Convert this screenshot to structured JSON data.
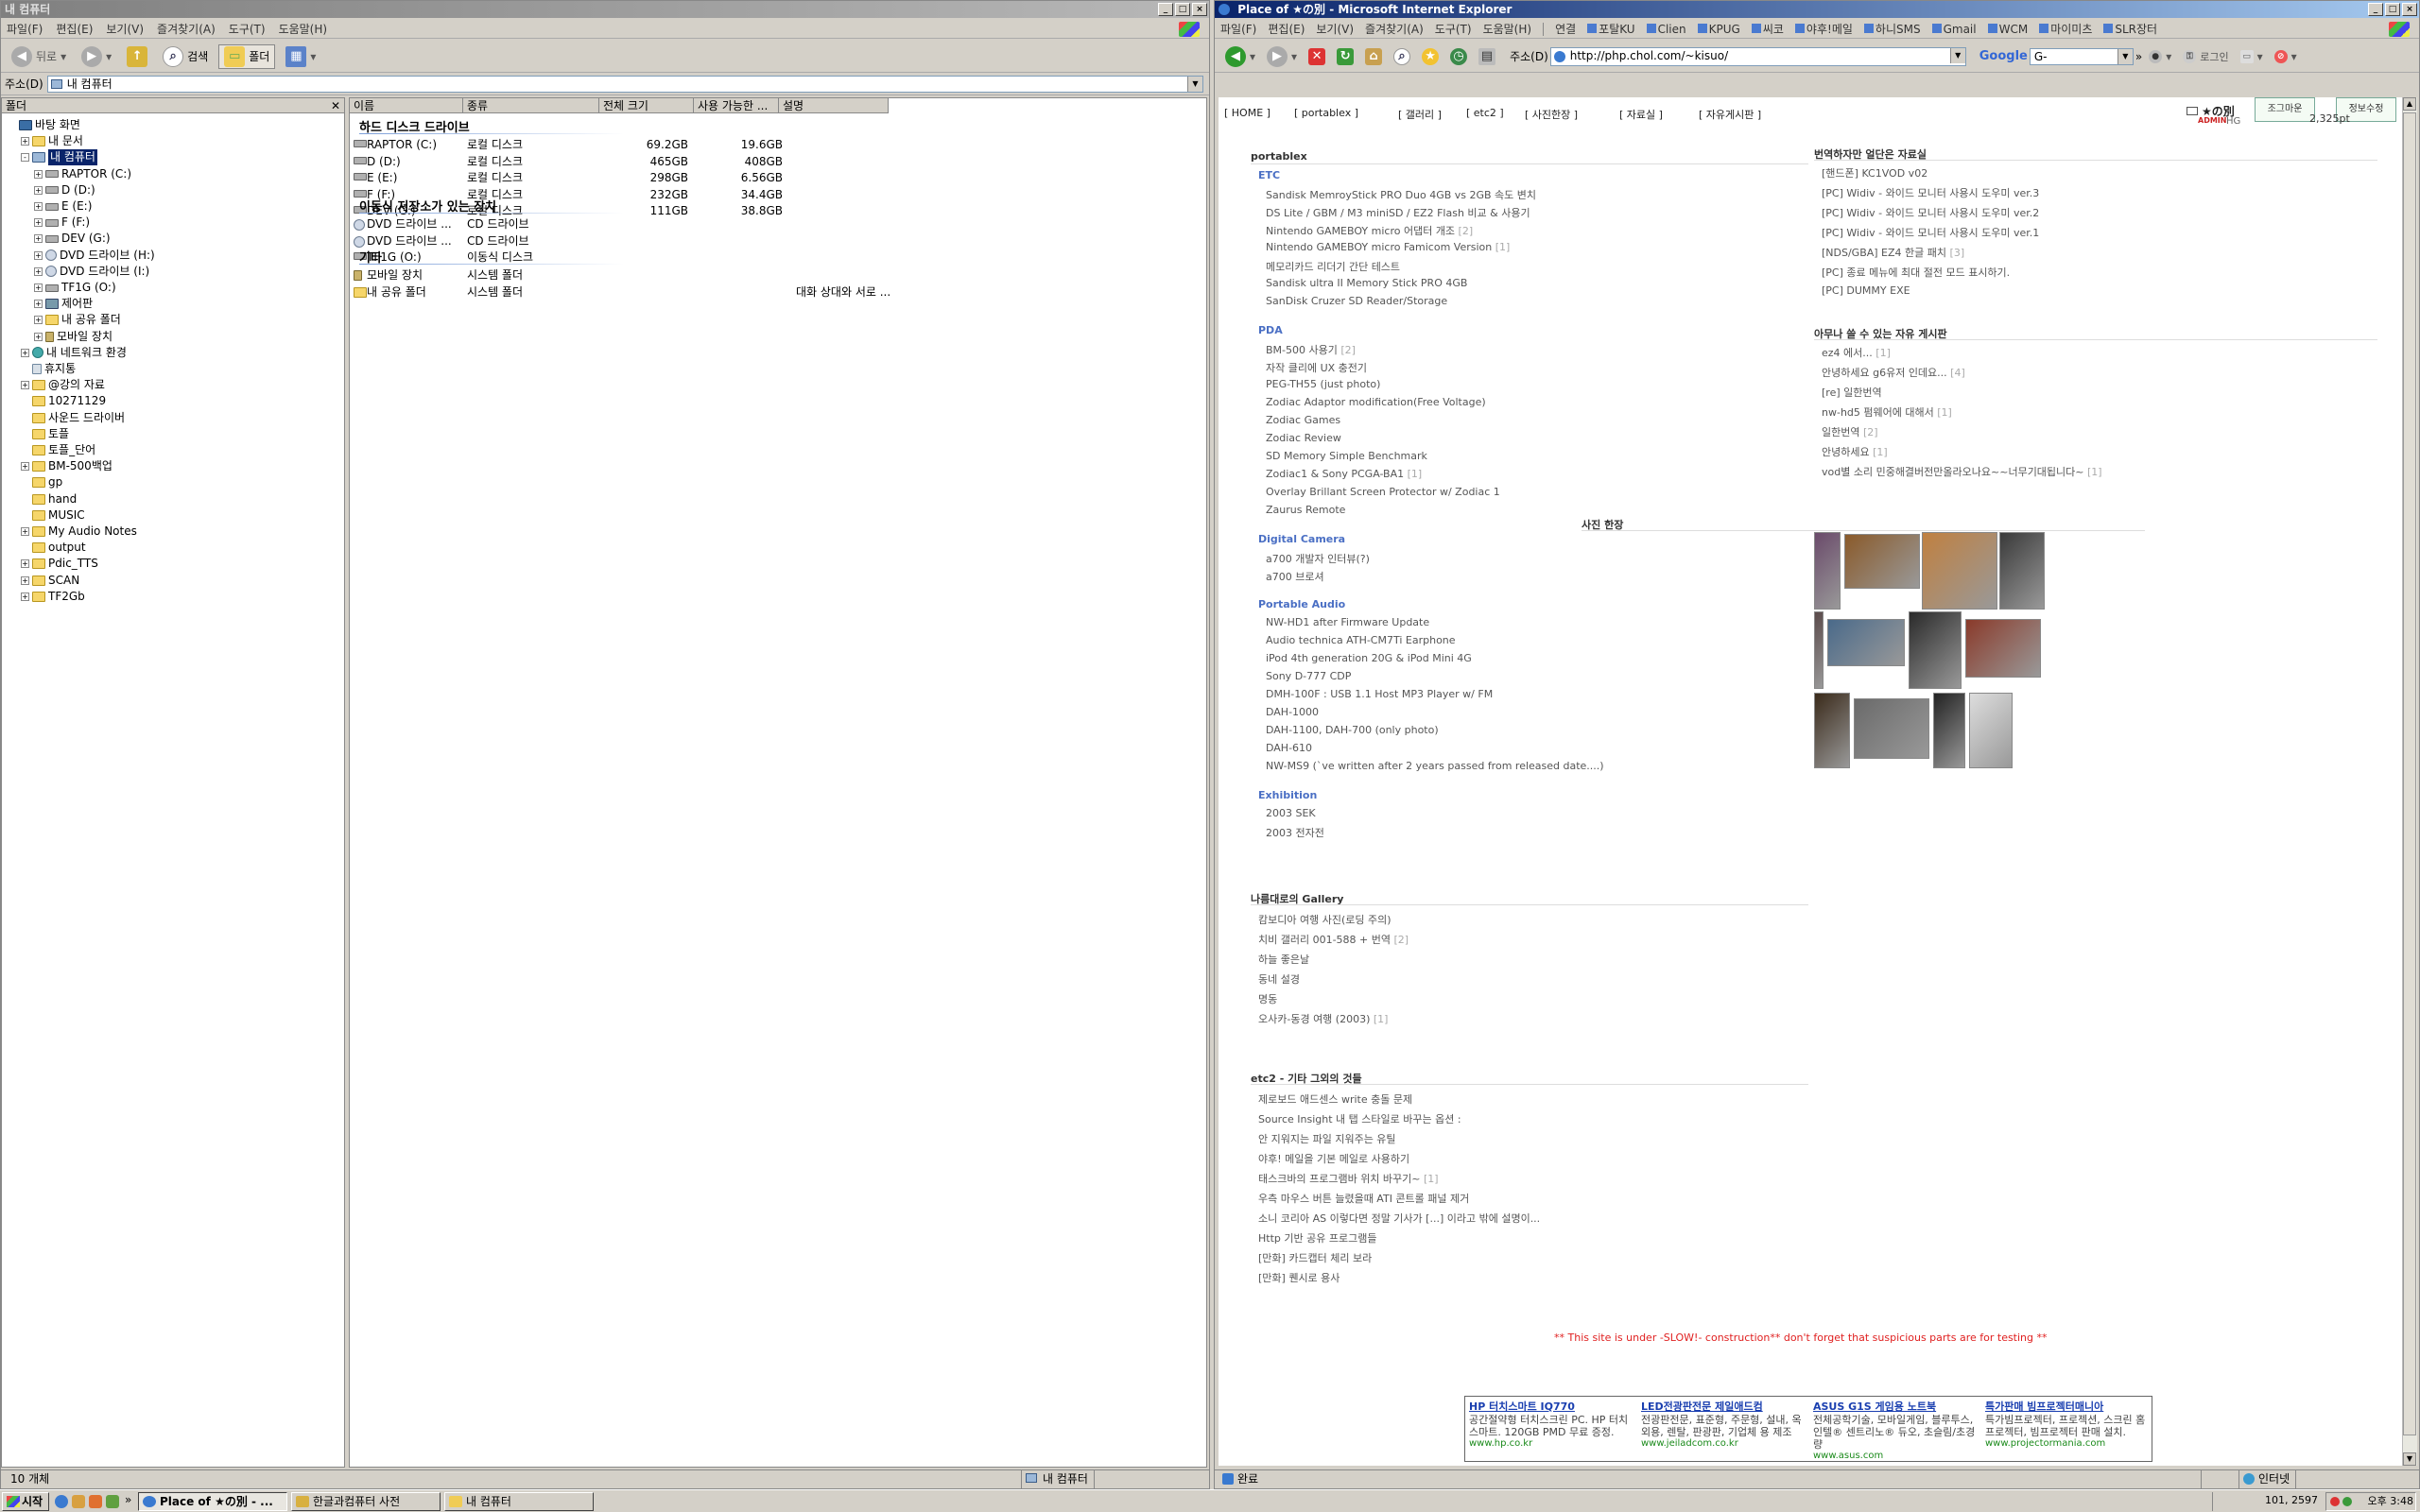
{
  "explorer": {
    "title": "내 컴퓨터",
    "menu": [
      "파일(F)",
      "편집(E)",
      "보기(V)",
      "즐겨찾기(A)",
      "도구(T)",
      "도움말(H)"
    ],
    "toolbar": {
      "back": "뒤로",
      "search": "검색",
      "folders": "폴더"
    },
    "address_label": "주소(D)",
    "address_value": "내 컴퓨터",
    "tree_header": "폴더",
    "tree": [
      {
        "label": "바탕 화면",
        "icon": "desk",
        "level": 0,
        "exp": ""
      },
      {
        "label": "내 문서",
        "icon": "folder",
        "level": 1,
        "exp": "+"
      },
      {
        "label": "내 컴퓨터",
        "icon": "pc",
        "level": 1,
        "exp": "-",
        "selected": true
      },
      {
        "label": "RAPTOR (C:)",
        "icon": "drive",
        "level": 2,
        "exp": "+"
      },
      {
        "label": "D (D:)",
        "icon": "drive",
        "level": 2,
        "exp": "+"
      },
      {
        "label": "E (E:)",
        "icon": "drive",
        "level": 2,
        "exp": "+"
      },
      {
        "label": "F (F:)",
        "icon": "drive",
        "level": 2,
        "exp": "+"
      },
      {
        "label": "DEV (G:)",
        "icon": "drive",
        "level": 2,
        "exp": "+"
      },
      {
        "label": "DVD 드라이브 (H:)",
        "icon": "cd",
        "level": 2,
        "exp": "+"
      },
      {
        "label": "DVD 드라이브 (I:)",
        "icon": "cd",
        "level": 2,
        "exp": "+"
      },
      {
        "label": "TF1G (O:)",
        "icon": "drive",
        "level": 2,
        "exp": "+"
      },
      {
        "label": "제어판",
        "icon": "ctrl",
        "level": 2,
        "exp": "+"
      },
      {
        "label": "내 공유 폴더",
        "icon": "folder",
        "level": 2,
        "exp": "+"
      },
      {
        "label": "모바일 장치",
        "icon": "mobile",
        "level": 2,
        "exp": "+"
      },
      {
        "label": "내 네트워크 환경",
        "icon": "net",
        "level": 1,
        "exp": "+"
      },
      {
        "label": "휴지통",
        "icon": "trash",
        "level": 1,
        "exp": ""
      },
      {
        "label": "@강의 자료",
        "icon": "folder",
        "level": 1,
        "exp": "+"
      },
      {
        "label": "10271129",
        "icon": "folder",
        "level": 1,
        "exp": ""
      },
      {
        "label": "사운드 드라이버",
        "icon": "folder",
        "level": 1,
        "exp": ""
      },
      {
        "label": "토플",
        "icon": "folder",
        "level": 1,
        "exp": ""
      },
      {
        "label": "토플_단어",
        "icon": "folder",
        "level": 1,
        "exp": ""
      },
      {
        "label": "BM-500백업",
        "icon": "folder",
        "level": 1,
        "exp": "+"
      },
      {
        "label": "gp",
        "icon": "folder",
        "level": 1,
        "exp": ""
      },
      {
        "label": "hand",
        "icon": "folder",
        "level": 1,
        "exp": ""
      },
      {
        "label": "MUSIC",
        "icon": "folder",
        "level": 1,
        "exp": ""
      },
      {
        "label": "My Audio Notes",
        "icon": "folder",
        "level": 1,
        "exp": "+"
      },
      {
        "label": "output",
        "icon": "folder",
        "level": 1,
        "exp": ""
      },
      {
        "label": "Pdic_TTS",
        "icon": "folder",
        "level": 1,
        "exp": "+"
      },
      {
        "label": "SCAN",
        "icon": "folder",
        "level": 1,
        "exp": "+"
      },
      {
        "label": "TF2Gb",
        "icon": "folder",
        "level": 1,
        "exp": "+"
      }
    ],
    "columns": [
      "이름",
      "종류",
      "전체 크기",
      "사용 가능한 ...",
      "설명"
    ],
    "groups": [
      {
        "title": "하드 디스크 드라이브",
        "rows": [
          {
            "name": "RAPTOR (C:)",
            "type": "로컬 디스크",
            "total": "69.2GB",
            "free": "19.6GB",
            "desc": "",
            "icon": "drive"
          },
          {
            "name": "D (D:)",
            "type": "로컬 디스크",
            "total": "465GB",
            "free": "408GB",
            "desc": "",
            "icon": "drive"
          },
          {
            "name": "E (E:)",
            "type": "로컬 디스크",
            "total": "298GB",
            "free": "6.56GB",
            "desc": "",
            "icon": "drive"
          },
          {
            "name": "F (F:)",
            "type": "로컬 디스크",
            "total": "232GB",
            "free": "34.4GB",
            "desc": "",
            "icon": "drive"
          },
          {
            "name": "DEV (G:)",
            "type": "로컬 디스크",
            "total": "111GB",
            "free": "38.8GB",
            "desc": "",
            "icon": "drive"
          }
        ]
      },
      {
        "title": "이동식 저장소가 있는 장치",
        "rows": [
          {
            "name": "DVD 드라이브 ...",
            "type": "CD 드라이브",
            "total": "",
            "free": "",
            "desc": "",
            "icon": "cd"
          },
          {
            "name": "DVD 드라이브 ...",
            "type": "CD 드라이브",
            "total": "",
            "free": "",
            "desc": "",
            "icon": "cd"
          },
          {
            "name": "TF1G (O:)",
            "type": "이동식 디스크",
            "total": "",
            "free": "",
            "desc": "",
            "icon": "drive"
          }
        ]
      },
      {
        "title": "기타",
        "rows": [
          {
            "name": "모바일 장치",
            "type": "시스템 폴더",
            "total": "",
            "free": "",
            "desc": "",
            "icon": "mobile"
          },
          {
            "name": "내 공유 폴더",
            "type": "시스템 폴더",
            "total": "",
            "free": "",
            "desc": "대화 상대와 서로 ...",
            "icon": "folder"
          }
        ]
      }
    ],
    "status_left": "10 개체",
    "status_right": "내 컴퓨터"
  },
  "ie": {
    "title": "Place of ★の別 - Microsoft Internet Explorer",
    "menu": [
      "파일(F)",
      "편집(E)",
      "보기(V)",
      "즐겨찾기(A)",
      "도구(T)",
      "도움말(H)"
    ],
    "links": [
      "연결",
      "포탈KU",
      "Clien",
      "KPUG",
      "씨코",
      "야후!메일",
      "하니SMS",
      "Gmail",
      "WCM",
      "마이미츠",
      "SLR장터"
    ],
    "address_label": "주소(D)",
    "address_value": "http://php.chol.com/~kisuo/",
    "google_label": "Google",
    "google_input": "G-",
    "login_label": "로그인",
    "nav": [
      "[ HOME ]",
      "[ portablex ]",
      "[ 갤러리 ]",
      "[ etc2 ]",
      "[ 사진한장 ]",
      "[ 자료실 ]",
      "[ 자유게시판 ]"
    ],
    "site_logo": "★の別",
    "admin_label": "ADMIN",
    "admin_user": "HG",
    "visit_btn": "조그마운",
    "info_btn": "정보수정",
    "points": "2,325pt",
    "portablex": {
      "title": "portablex",
      "sections": [
        {
          "title": "ETC",
          "items": [
            "Sandisk MemroyStick PRO Duo 4GB vs 2GB 속도 변치",
            "DS Lite / GBM / M3 miniSD / EZ2 Flash 비교 & 사용기",
            "Nintendo GAMEBOY micro 어댑터 개조 [2]",
            "Nintendo GAMEBOY micro Famicom Version [1]",
            "메모리카드 리더기 간단 테스트",
            "Sandisk ultra II Memory Stick PRO 4GB",
            "SanDisk Cruzer SD Reader/Storage"
          ]
        },
        {
          "title": "PDA",
          "items": [
            "BM-500 사용기 [2]",
            "자작 클리에 UX 충전기",
            "PEG-TH55 (just photo)",
            "Zodiac Adaptor modification(Free Voltage)",
            "Zodiac Games",
            "Zodiac Review",
            "SD Memory Simple Benchmark",
            "Zodiac1 & Sony PCGA-BA1 [1]",
            "Overlay Brillant Screen Protector w/ Zodiac 1",
            "Zaurus Remote"
          ]
        },
        {
          "title": "Digital Camera",
          "items": [
            "a700 개발자 인터뷰(?)",
            "a700 브로셔"
          ]
        },
        {
          "title": "Portable Audio",
          "items": [
            "NW-HD1 after Firmware Update",
            "Audio technica ATH-CM7Ti Earphone",
            "iPod 4th generation 20G & iPod Mini 4G",
            "Sony D-777 CDP",
            "DMH-100F : USB 1.1 Host MP3 Player w/ FM",
            "DAH-1000",
            "DAH-1100, DAH-700 (only photo)",
            "DAH-610",
            "NW-MS9 (`ve written after 2 years passed from released date....)"
          ]
        },
        {
          "title": "Exhibition",
          "items": [
            "2003 SEK",
            "2003 전자전"
          ]
        }
      ]
    },
    "gallery": {
      "title": "나름대로의 Gallery",
      "items": [
        "캄보디아 여행 사진(로딩 주의)",
        "치비 갤러리 001-588 + 번역 [2]",
        "하늘 좋은날",
        "동네 설경",
        "명동",
        "오사카-동경 여행 (2003) [1]"
      ]
    },
    "etc2": {
      "title": "etc2 - 기타 그외의 것들",
      "items": [
        "제로보드 애드센스 write 충돌 문제",
        "Source Insight 내 탭 스타일로 바꾸는 옵션 :",
        "안 지워지는 파일 지워주는 유틸",
        "야후! 메일을 기본 메일로 사용하기",
        "태스크바의 프로그램바 위치 바꾸기~ [1]",
        "우측 마우스 버튼 늘렸을때 ATI 콘트롤 패널 제거",
        "소니 코리아 AS 이렇다면 정말 기사가 [...] 이라고 밖에 설명이...",
        "Http 기반 공유 프로그램들",
        "[만화] 카드캡터 체리 보라",
        "[만화] 퀜시로 용사"
      ]
    },
    "right_sections": [
      {
        "title": "번역하자만 얼단은 자료실",
        "items": [
          "[핸드폰] KC1VOD v02",
          "[PC] Widiv - 와이드 모니터 사용시 도우미 ver.3",
          "[PC] Widiv - 와이드 모니터 사용시 도우미 ver.2",
          "[PC] Widiv - 와이드 모니터 사용시 도우미 ver.1",
          "[NDS/GBA] EZ4 한글 패치 [3]",
          "[PC] 종료 메뉴에 최대 절전 모드 표시하기.",
          "[PC] DUMMY EXE"
        ]
      },
      {
        "title": "아무나 쓸 수 있는 자유 게시판",
        "items": [
          "ez4 에서... [1]",
          "안녕하세요 g6유저 인데요... [4]",
          "[re] 일한번역",
          "nw-hd5 펌웨어에 대해서 [1]",
          "일한번역 [2]",
          "안녕하세요 [1]",
          "vod별 소리 민중해결버전만올라오나요~~너무기대됩니다~ [1]"
        ]
      }
    ],
    "photo_title": "사진 한장",
    "construction": "** This site is under -SLOW!- construction** don't forget that suspicious parts are for testing **",
    "ads": [
      {
        "title": "HP 터치스마트 IQ770",
        "text": "공간절약형 터치스크린 PC. HP 터치스마트. 120GB PMD 무료 증정.",
        "url": "www.hp.co.kr"
      },
      {
        "title": "LED전광판전문 제일애드컴",
        "text": "전광판전문, 표준형, 주문형, 설내, 옥외용, 렌탈, 판광판, 기업체 용 제조",
        "url": "www.jeiladcom.co.kr"
      },
      {
        "title": "ASUS G1S 게임용 노트북",
        "text": "전체공학기술, 모바일게임, 블루투스, 인텔® 센트리노® 듀오, 초슬림/초경량",
        "url": "www.asus.com"
      },
      {
        "title": "특가판매 빔프로젝터매니아",
        "text": "특가빔프로젝터, 프로젝션, 스크린 홈프로젝터, 빔프로젝터 판매 설치.",
        "url": "www.projectormania.com"
      }
    ],
    "status_left": "완료",
    "status_zone": "인터넷"
  },
  "taskbar": {
    "start": "시작",
    "tasks": [
      "Place of ★の別 - ...",
      "한글과컴퓨터 사전",
      "내 컴퓨터"
    ],
    "tray_time": "오후 3:48",
    "coords": "101, 2597"
  }
}
